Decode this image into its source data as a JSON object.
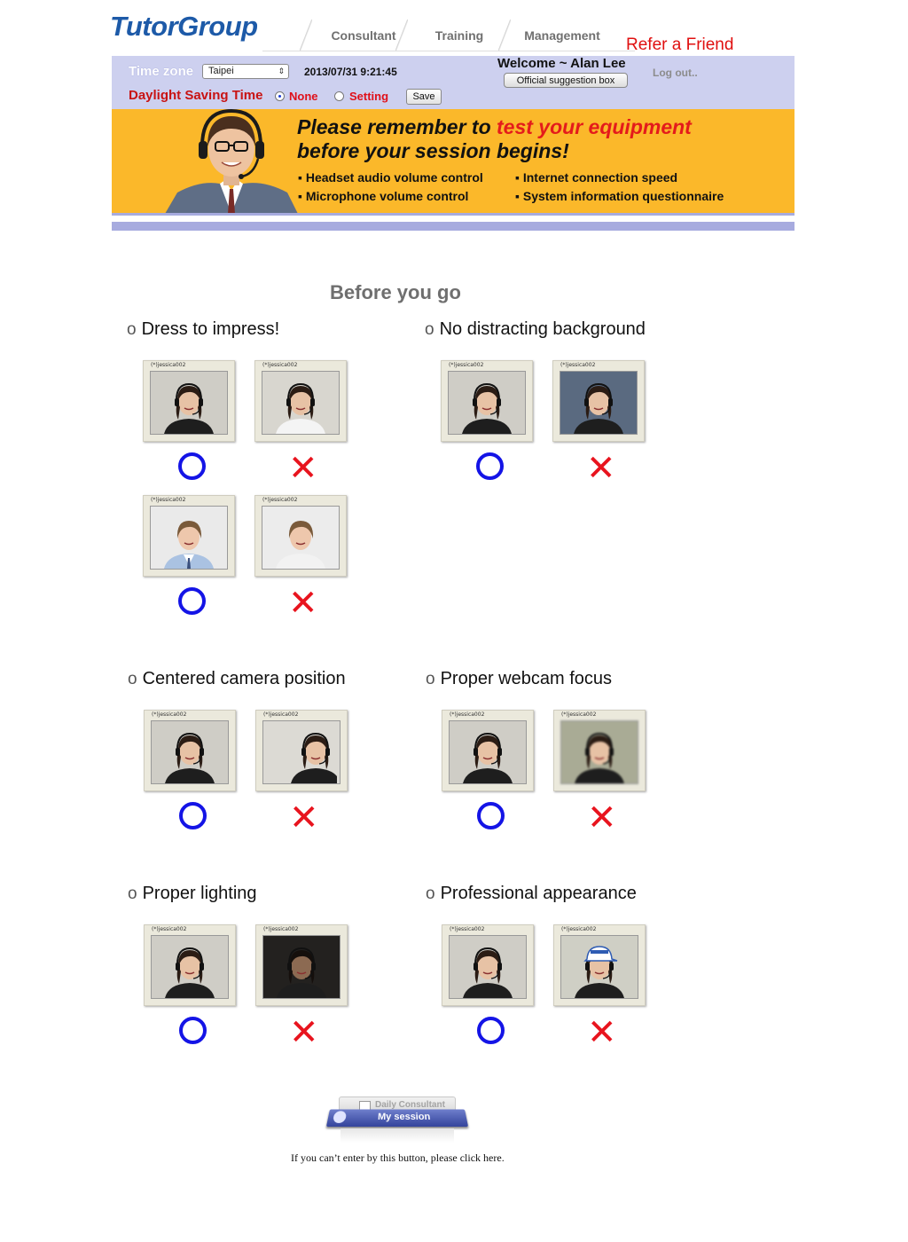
{
  "header": {
    "logo": "TutorGroup",
    "nav": [
      "Consultant",
      "Training",
      "Management"
    ],
    "refer_friend": "Refer a Friend"
  },
  "infobar": {
    "timezone_label": "Time zone",
    "timezone_value": "Taipei",
    "datetime": "2013/07/31 9:21:45",
    "welcome": "Welcome ~ Alan Lee",
    "suggestion_button": "Official suggestion box",
    "logout": "Log out..",
    "dst_label": "Daylight Saving Time",
    "dst_options": [
      "None",
      "Setting"
    ],
    "dst_selected": "None",
    "save_button": "Save"
  },
  "banner": {
    "line1_plain": "Please remember to ",
    "line1_highlight": "test your equipment",
    "line2": "before your session begins!",
    "bullets": [
      "▪ Headset audio volume control",
      "▪ Microphone volume control",
      "▪ Internet connection speed",
      "▪ System information questionnaire"
    ]
  },
  "guide": {
    "title": "Before you go",
    "bullet_char": "o",
    "thumb_caption": "(*)jessica002",
    "categories": [
      "Dress to impress!",
      "No distracting background",
      "Centered camera position",
      "Proper webcam focus",
      "Proper lighting",
      "Professional appearance"
    ],
    "cross_mark": "✕"
  },
  "session": {
    "tab_back": "Daily Consultant",
    "tab_front": "My session",
    "footer": "If you can’t enter by this button, please click here."
  },
  "colors": {
    "brand_blue": "#1d5aa8",
    "info_bar": "#cdd0ef",
    "banner_orange": "#fbb82a",
    "ok_blue": "#1414e6",
    "ng_red": "#e8141e"
  }
}
